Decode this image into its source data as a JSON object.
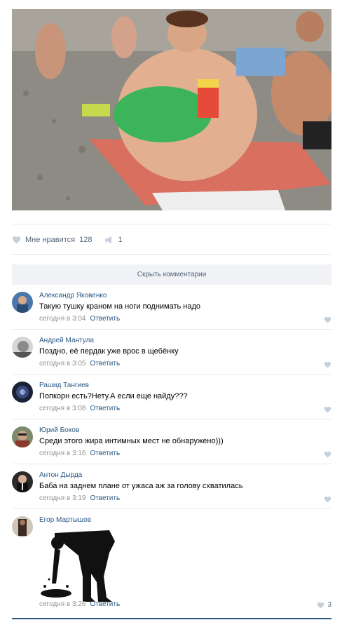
{
  "post": {
    "photo_icon": "beach-photo",
    "likes_label": "Мне нравится",
    "likes_count": "128",
    "shares_count": "1"
  },
  "hide_comments_label": "Скрыть комментарии",
  "comments": [
    {
      "author": "Александр Яковенко",
      "text": "Такую тушку краном на ноги поднимать надо",
      "time": "сегодня в 3:04",
      "reply": "Ответить"
    },
    {
      "author": "Андрей Мантула",
      "text": "Поздно, её пердак уже врос в щебёнку",
      "time": "сегодня в 3:05",
      "reply": "Ответить"
    },
    {
      "author": "Рашид Тангиев",
      "text": "Попкорн есть?Нету.А если еще найду???",
      "time": "сегодня в 3:08",
      "reply": "Ответить"
    },
    {
      "author": "Юрий Боков",
      "text": "Среди этого жира интимных мест не обнаружено)))",
      "time": "сегодня в 3:16",
      "reply": "Ответить"
    },
    {
      "author": "Антон Дырда",
      "text": "Баба на заднем плане от ужаса аж за голову схватилась",
      "time": "сегодня в 3:19",
      "reply": "Ответить"
    },
    {
      "author": "Егор Мартышов",
      "sticker": "vomiting-man-sticker",
      "time": "сегодня в 3:26",
      "reply": "Ответить",
      "likes": "3"
    }
  ],
  "colors": {
    "link": "#2a5885",
    "muted": "#939393",
    "icon": "#c5d0db",
    "bar": "#f0f2f5"
  }
}
